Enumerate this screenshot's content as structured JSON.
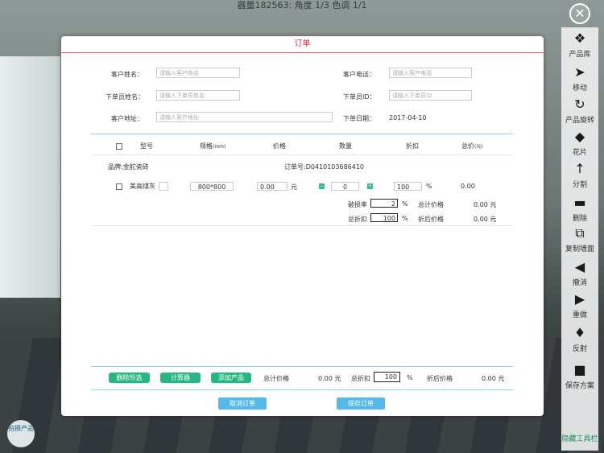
{
  "top_status": "器量182563: 角度 1/3 色调 1/1",
  "modal_title": "订单",
  "customer": {
    "name_label": "客户姓名：",
    "name_placeholder": "请输入客户姓名",
    "phone_label": "客户电话：",
    "phone_placeholder": "请输入客户电话",
    "orderer_label": "下单员姓名：",
    "orderer_placeholder": "请输入下单员姓名",
    "orderer_id_label": "下单员ID：",
    "orderer_id_placeholder": "请输入下单员ID",
    "address_label": "客户地址：",
    "address_placeholder": "请输入客户地址",
    "date_label": "下单日期：",
    "date_value": "2017-04-10"
  },
  "table": {
    "headers": {
      "model": "型号",
      "spec": "规格",
      "spec_unit": "(mm)",
      "price": "价格",
      "quantity": "数量",
      "discount": "折扣",
      "total": "总价",
      "total_unit": "(元)"
    },
    "brand": "品牌:金舵瓷砖",
    "order_no": "订单号:D0410103686410",
    "row": {
      "model": "美高煤灰",
      "spec": "800*800",
      "price": "0.00",
      "price_unit": "元",
      "quantity": "0",
      "discount": "100",
      "discount_unit": "%",
      "total": "0.00"
    },
    "loss_label": "破损率",
    "loss_value": "2",
    "loss_unit": "%",
    "total_price_label": "总计价格",
    "total_price_value": "0.00 元",
    "total_discount_label": "总折扣",
    "total_discount_value": "100",
    "total_discount_unit": "%",
    "after_discount_label": "折后价格",
    "after_discount_value": "0.00 元"
  },
  "footer": {
    "delete_selected": "删除所选",
    "calculator": "计算器",
    "add_product": "添加产品",
    "total_price_label": "总计价格",
    "total_price_value": "0.00 元",
    "total_discount_label": "总折扣",
    "total_discount_value": "100",
    "total_discount_unit": "%",
    "after_discount_label": "折后价格",
    "after_discount_value": "0.00 元",
    "cancel_order": "取消订单",
    "save_order": "保存订单"
  },
  "toolbar": [
    {
      "label": "产品库",
      "icon": "cubes-icon"
    },
    {
      "label": "移动",
      "icon": "navigate-arrow-icon"
    },
    {
      "label": "产品旋转",
      "icon": "rotate-icon"
    },
    {
      "label": "花片",
      "icon": "diamond-tile-icon"
    },
    {
      "label": "分割",
      "icon": "split-arrow-icon"
    },
    {
      "label": "删除",
      "icon": "trash-icon"
    },
    {
      "label": "复制墙面",
      "icon": "copy-wall-icon"
    },
    {
      "label": "撤消",
      "icon": "undo-icon"
    },
    {
      "label": "重做",
      "icon": "redo-icon"
    },
    {
      "label": "反射",
      "icon": "bulb-icon"
    },
    {
      "label": "保存方案",
      "icon": "save-icon"
    },
    {
      "label": "隐藏工具栏",
      "icon": "hide-toolbar-icon"
    }
  ],
  "capture_label": "拍摄产品"
}
